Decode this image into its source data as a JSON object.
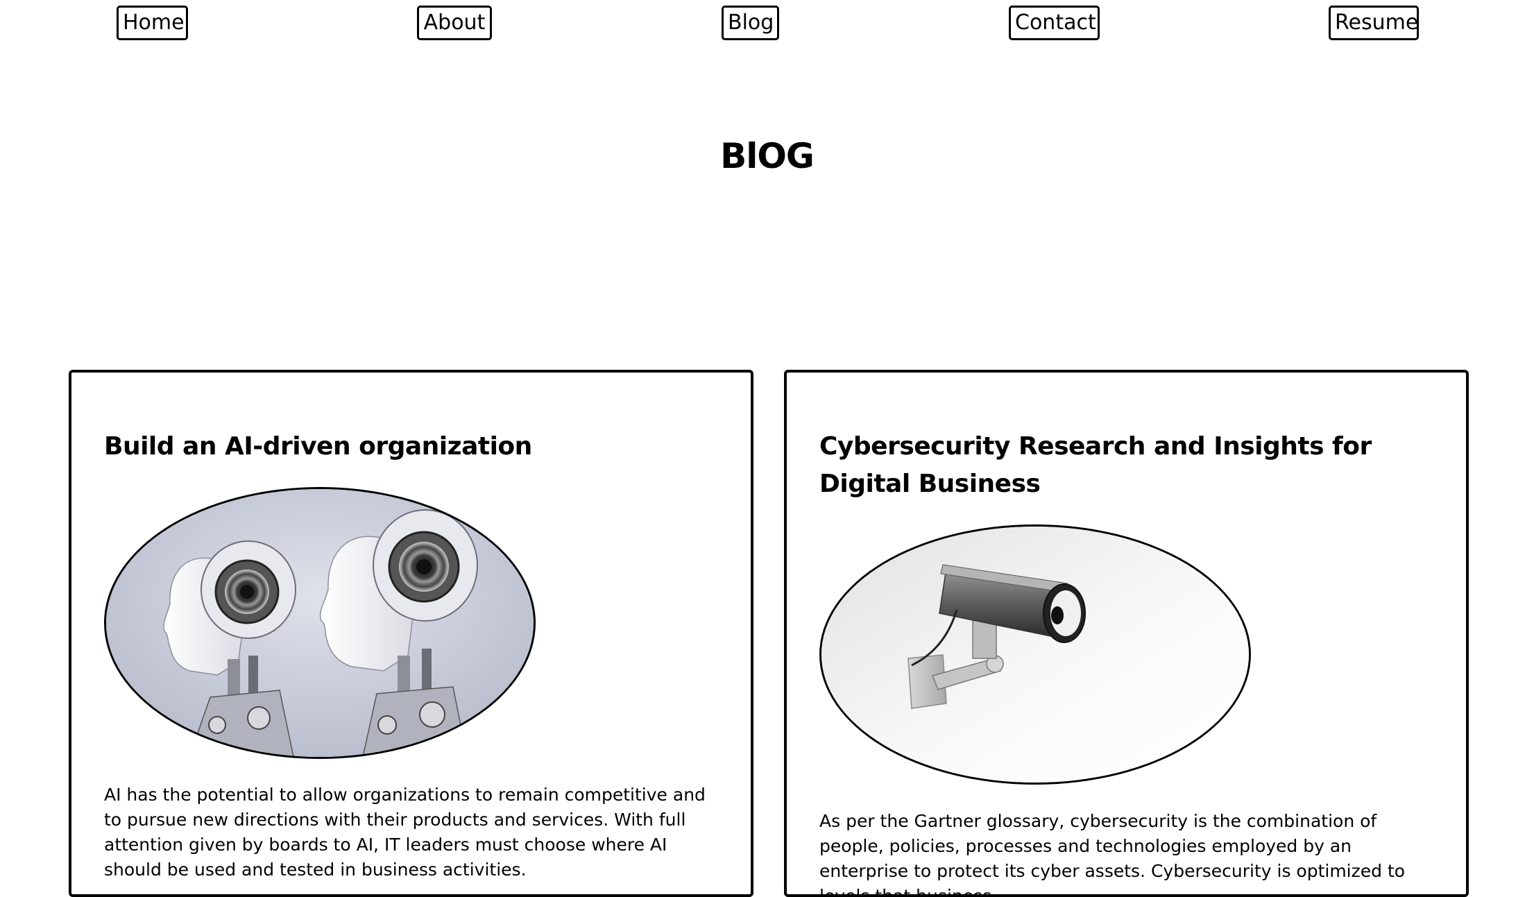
{
  "nav": {
    "items": [
      {
        "label": "Home"
      },
      {
        "label": "About"
      },
      {
        "label": "Blog"
      },
      {
        "label": "Contact"
      },
      {
        "label": "Resume"
      }
    ]
  },
  "page": {
    "title": "BlOG"
  },
  "posts": [
    {
      "title": "Build an AI-driven organization",
      "image_icon": "robot-heads-image",
      "body": "AI has the potential to allow organizations to remain competitive and to pursue new directions with their products and services. With full attention given by boards to AI, IT leaders must choose where AI should be used and tested in business activities."
    },
    {
      "title": "Cybersecurity Research and Insights for Digital Business",
      "image_icon": "security-camera-image",
      "body": "As per the Gartner glossary, cybersecurity is the combination of people, policies, processes and technologies employed by an enterprise to protect its cyber assets. Cybersecurity is optimized to levels that business"
    }
  ],
  "colors": {
    "border": "#000000",
    "background": "#ffffff",
    "text": "#000000",
    "robot_bg": "#c9ccd8"
  }
}
